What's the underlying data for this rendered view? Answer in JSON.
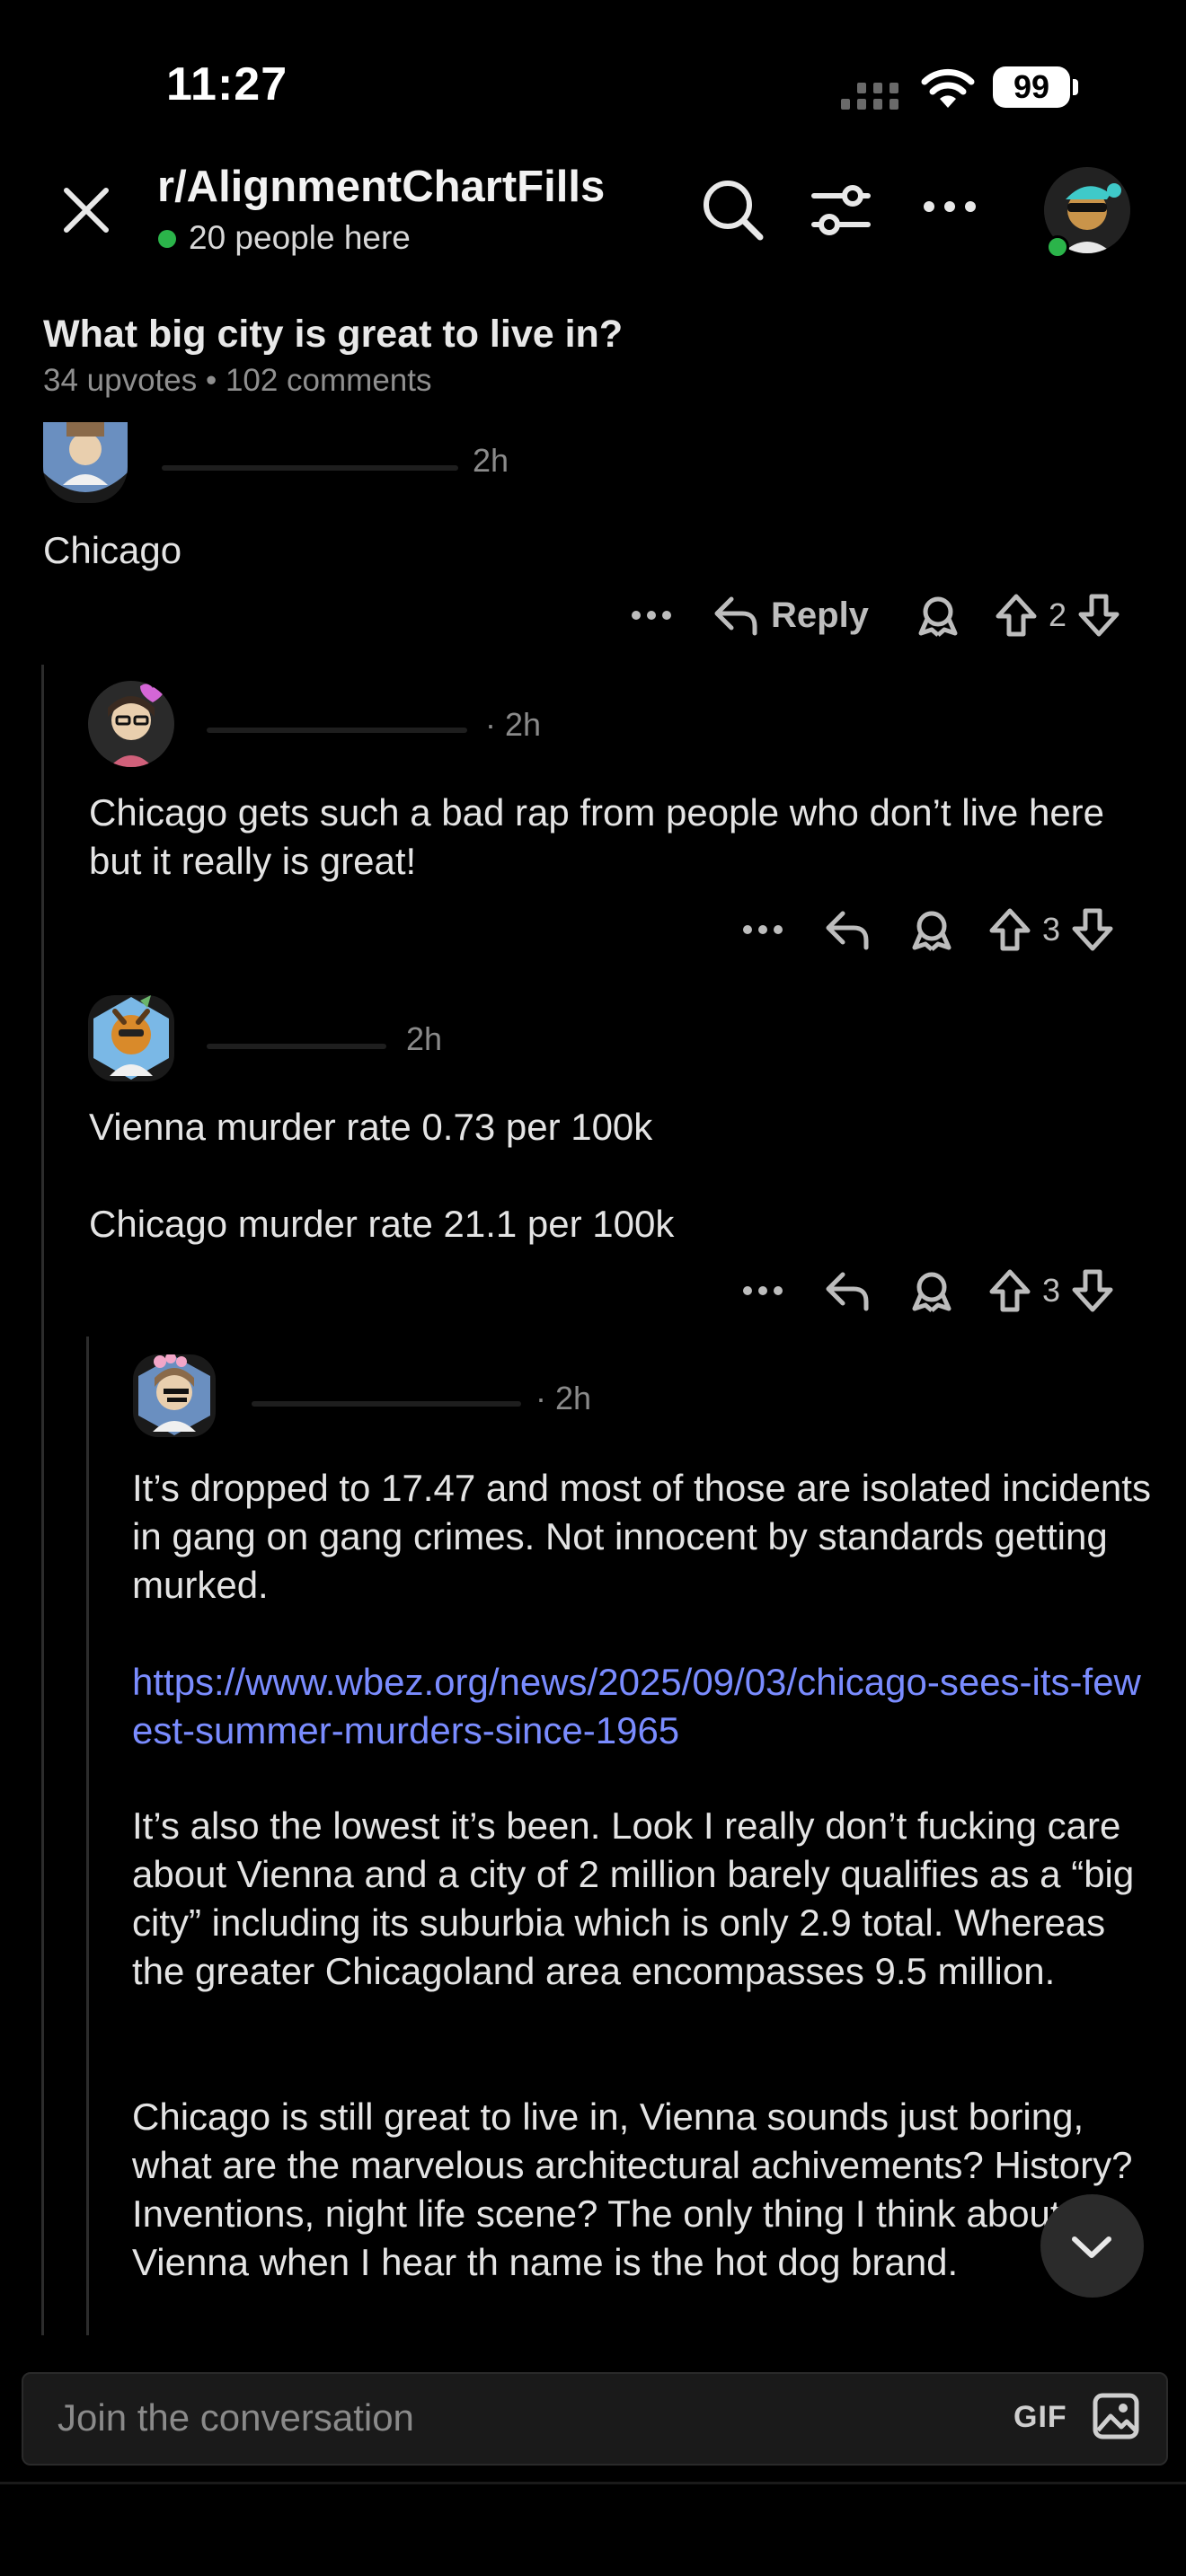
{
  "status_bar": {
    "time": "11:27",
    "battery": "99",
    "icons": [
      "signal-icon",
      "wifi-icon",
      "battery-icon"
    ]
  },
  "header": {
    "subreddit": "r/AlignmentChartFills",
    "online_count": "20 people here",
    "icons": [
      "close-icon",
      "search-icon",
      "filter-icon",
      "more-icon",
      "avatar"
    ]
  },
  "post": {
    "title": "What big city is great to live in?",
    "meta": "34 upvotes • 102 comments"
  },
  "comments": [
    {
      "time": "2h",
      "body": "Chicago",
      "reply_label": "Reply",
      "votes": "2"
    },
    {
      "time": "· 2h",
      "body": "Chicago gets such a bad rap from people who don’t live here but it really is great!",
      "votes": "3"
    },
    {
      "time": "2h",
      "body_lines": [
        "Vienna murder rate 0.73 per 100k",
        "Chicago murder rate 21.1 per 100k"
      ],
      "votes": "3"
    },
    {
      "time": "· 2h",
      "para1": "It’s dropped to 17.47 and most of those are isolated incidents in gang on gang crimes. Not innocent by standards getting murked.",
      "link": "https://www.wbez.org/news/2025/09/03/chicago-sees-its-fewest-summer-murders-since-1965",
      "para2": "It’s also the lowest it’s been. Look I really don’t fucking care about Vienna and a city of 2 million barely qualifies as a “big city” including its suburbia which is only 2.9 total. Whereas the greater Chicagoland area encompasses 9.5 million.",
      "para3": "Chicago is still great to live in, Vienna sounds just boring, what are the marvelous architectural achivements? History? Inventions, night life scene? The only thing I think about Vienna when I hear th name is the hot dog brand."
    }
  ],
  "composer": {
    "placeholder": "Join the conversation",
    "gif_label": "GIF"
  },
  "colors": {
    "background": "#000000",
    "online": "#2bb44a",
    "link": "#7a8cff"
  }
}
